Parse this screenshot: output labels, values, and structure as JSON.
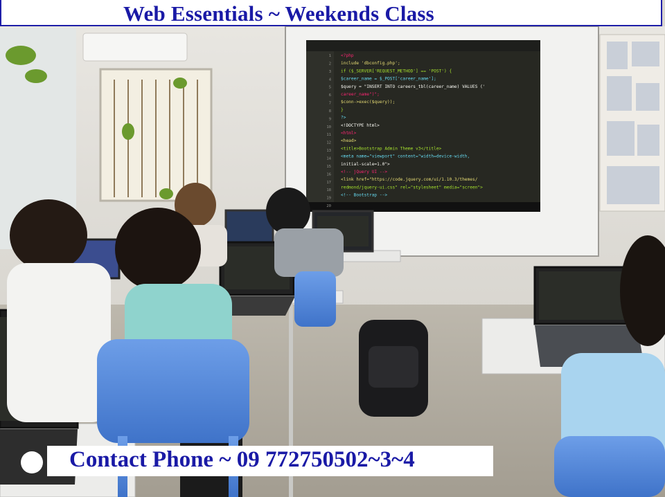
{
  "banner": {
    "title": "Web Essentials ~ Weekends Class",
    "contact": "Contact Phone ~ 09 772750502~3~4"
  },
  "projected_code": {
    "lines": [
      "<?php",
      "include 'dbconfig.php';",
      "if ($_SERVER['REQUEST_METHOD'] == 'POST') {",
      "$career_name = $_POST['career_name'];",
      "$query = \"INSERT INTO careers_tbl(career_name) VALUES ('",
      "career_name\")\";",
      "$conn->exec($query));",
      "}",
      "?>",
      "<!DOCTYPE html>",
      "<html>",
      "<head>",
      "<title>Bootstrap Admin Theme v3</title>",
      "<meta name=\"viewport\" content=\"width=device-width,",
      "initial-scale=1.0\">",
      "<!-- jQuery UI -->",
      "<link href=\"https://code.jquery.com/ui/1.10.3/themes/",
      "redmond/jquery-ui.css\" rel=\"stylesheet\" media=\"screen\">",
      "<!-- Bootstrap -->"
    ],
    "line_numbers": [
      "1",
      "2",
      "3",
      "4",
      "5",
      "6",
      "7",
      "8",
      "9",
      "10",
      "11",
      "12",
      "13",
      "14",
      "15",
      "16",
      "17",
      "18",
      "19",
      "20"
    ]
  },
  "colors": {
    "banner_text": "#1a1aa6",
    "banner_bg": "#ffffff",
    "editor_bg": "#272822"
  }
}
